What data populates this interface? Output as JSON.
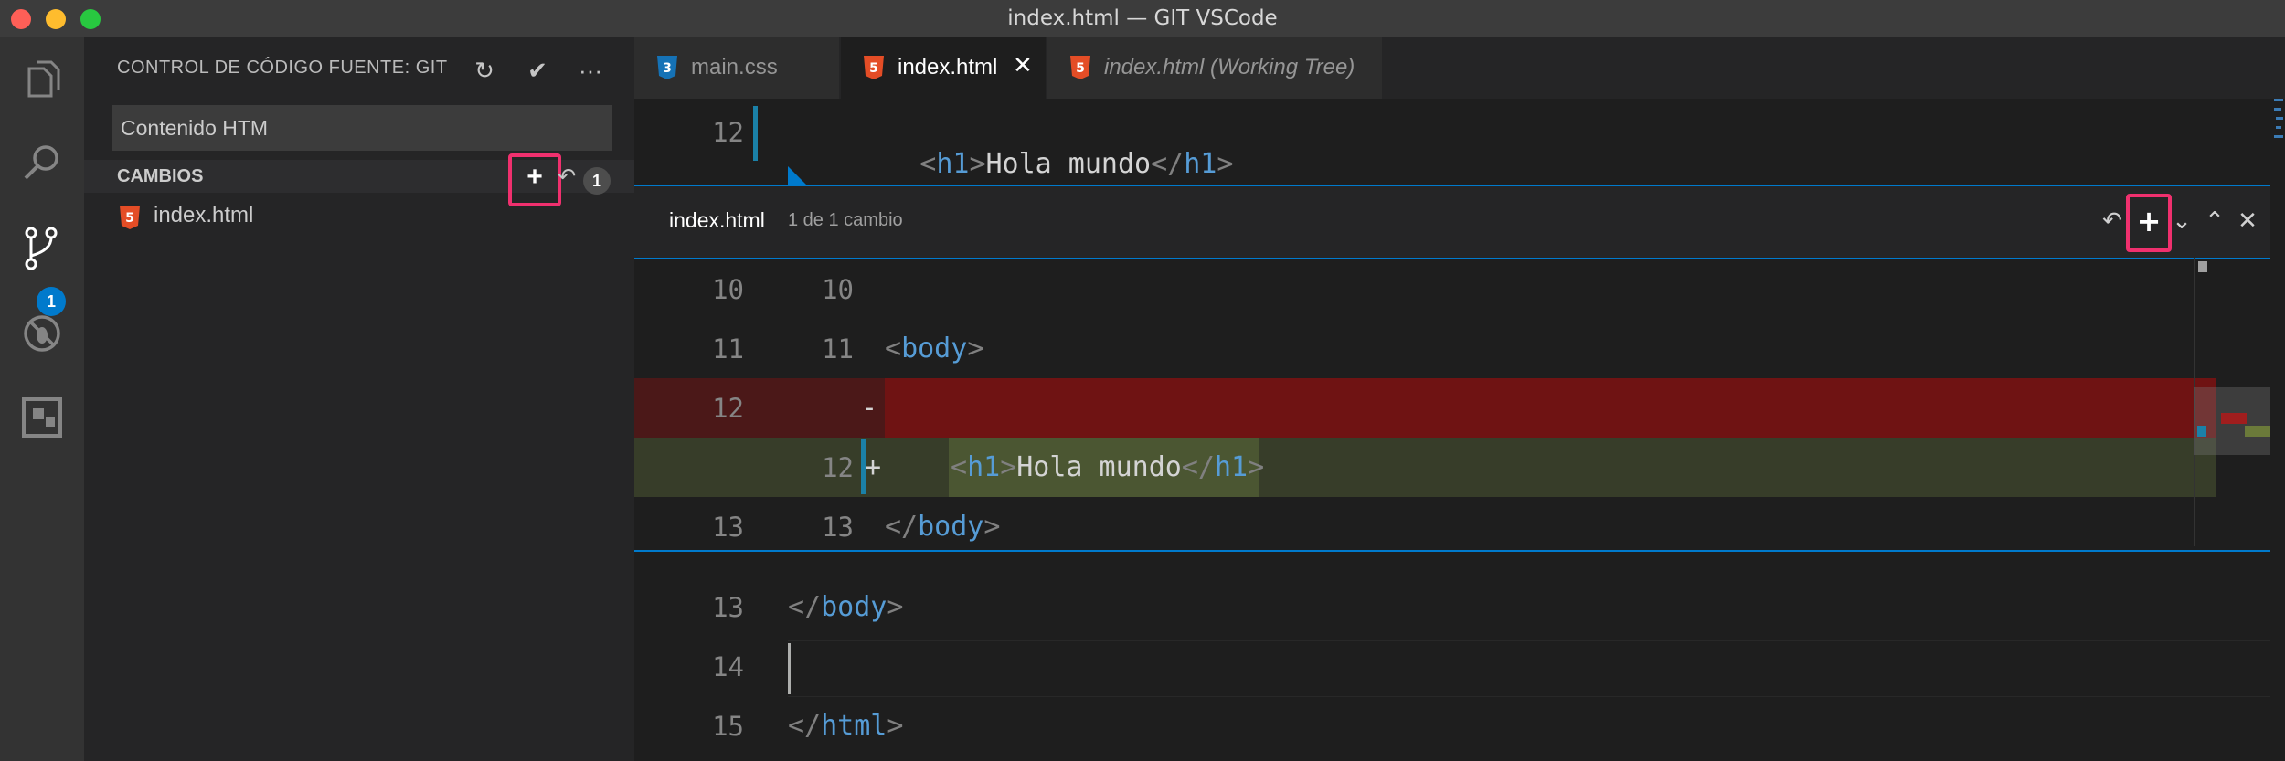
{
  "window": {
    "title": "index.html — GIT VSCode"
  },
  "activity_bar": {
    "scm_badge": "1"
  },
  "sidebar": {
    "title": "CONTROL DE CÓDIGO FUENTE: GIT",
    "commit_message": "Contenido HTM",
    "changes_label": "CAMBIOS",
    "changes_count": "1",
    "files": [
      {
        "name": "index.html",
        "icon": "html5-icon"
      }
    ]
  },
  "tabs": [
    {
      "label": "main.css",
      "icon": "css3-icon",
      "active": false,
      "italic": false
    },
    {
      "label": "index.html",
      "icon": "html5-icon",
      "active": true,
      "italic": false
    },
    {
      "label": "index.html (Working Tree)",
      "icon": "html5-icon",
      "active": false,
      "italic": true
    }
  ],
  "editor": {
    "top_line": {
      "num": "12",
      "open_tag": "h1",
      "text": "Hola mundo",
      "close_tag": "h1"
    },
    "bottom_lines": [
      {
        "num": "13",
        "code": "</body>"
      },
      {
        "num": "14",
        "code": ""
      },
      {
        "num": "15",
        "code": "</html>"
      }
    ]
  },
  "peek": {
    "file": "index.html",
    "description": "1 de 1 cambio",
    "lines": [
      {
        "old": "10",
        "new": "10",
        "marker": "",
        "code": "",
        "type": "context"
      },
      {
        "old": "11",
        "new": "11",
        "marker": "",
        "code": "<body>",
        "type": "context"
      },
      {
        "old": "12",
        "new": "",
        "marker": "-",
        "code": "",
        "type": "removed"
      },
      {
        "old": "",
        "new": "12",
        "marker": "+",
        "code": "<h1>Hola mundo</h1>",
        "type": "added"
      },
      {
        "old": "13",
        "new": "13",
        "marker": "",
        "code": "</body>",
        "type": "context"
      }
    ]
  },
  "colors": {
    "accent": "#007acc",
    "highlight": "#f0306e",
    "removed_bg": "#6f1313",
    "added_bg": "#373d29",
    "html_icon": "#e44d26",
    "css_icon": "#1572b6"
  }
}
